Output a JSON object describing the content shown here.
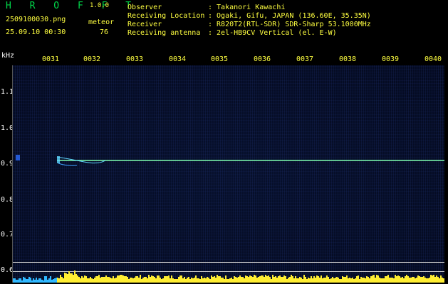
{
  "header": {
    "app_name": "H R O F F T",
    "version": "1.0.0",
    "filename": "2509100030.png",
    "datetime": "25.09.10 00:30",
    "count_label": "meteor",
    "count_value": "76"
  },
  "info": [
    {
      "label": "Observer",
      "value": ": Takanori Kawachi"
    },
    {
      "label": "Receiving Location",
      "value": ": Ogaki, Gifu, JAPAN (136.60E, 35.35N)"
    },
    {
      "label": "Receiver",
      "value": ": R820T2(RTL-SDR) SDR-Sharp 53.1000MHz"
    },
    {
      "label": "Receiving antenna",
      "value": ": 2el-HB9CV Vertical (el. E-W)"
    }
  ],
  "axis": {
    "y_unit": "kHz",
    "x_ticks": [
      "0031",
      "0032",
      "0033",
      "0034",
      "0035",
      "0036",
      "0037",
      "0038",
      "0039",
      "0040"
    ],
    "y_ticks": [
      "1.1",
      "1.0",
      "0.9",
      "0.8",
      "0.7",
      "0.6"
    ]
  },
  "colors": {
    "text": "#ffff40",
    "logo": "#00d84a",
    "trace": "#7fffb0",
    "background": "#050c24"
  }
}
